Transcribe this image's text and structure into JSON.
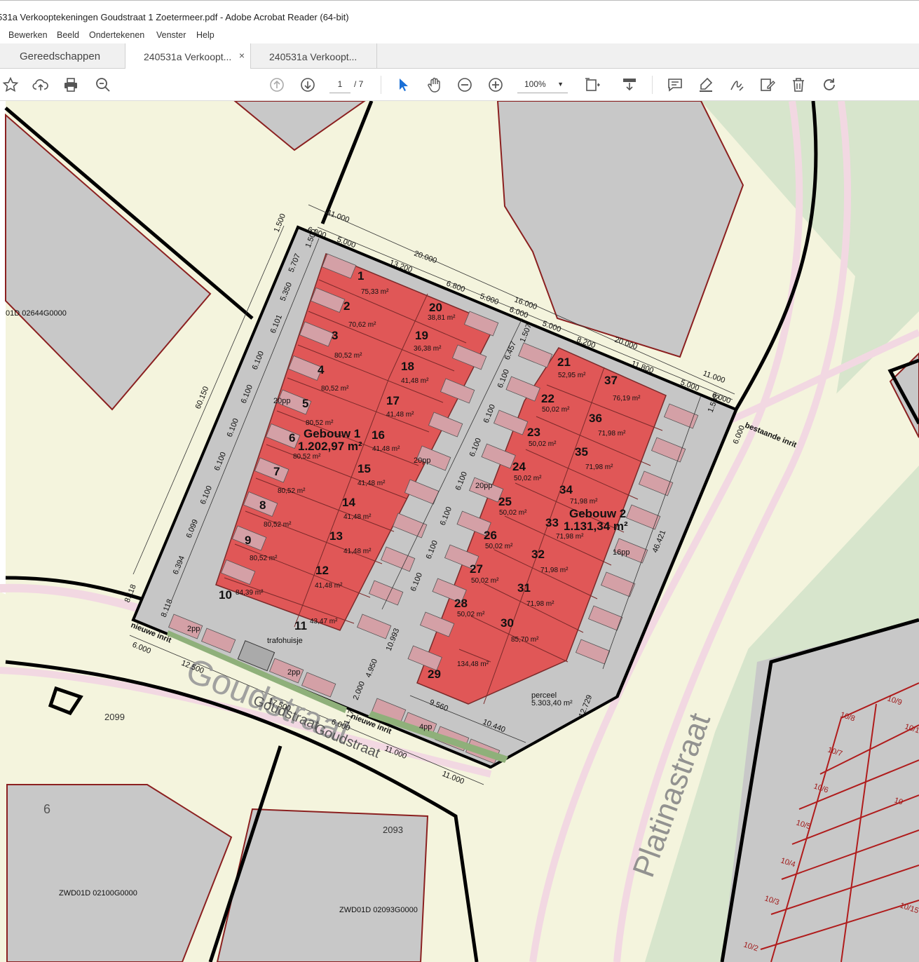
{
  "window": {
    "title": "531a Verkooptekeningen Goudstraat 1 Zoetermeer.pdf - Adobe Acrobat Reader (64-bit)"
  },
  "menu": [
    "Bewerken",
    "Beeld",
    "Ondertekenen",
    "Venster",
    "Help"
  ],
  "tabs": [
    {
      "label": "Gereedschappen"
    },
    {
      "label": "240531a Verkoopt...",
      "close": "×"
    },
    {
      "label": "240531a Verkoopt..."
    }
  ],
  "toolbar": {
    "page_current": "1",
    "page_total": "/ 7",
    "zoom": "100%",
    "icons": [
      "star-icon",
      "upload-cloud-icon",
      "print-icon",
      "search-icon",
      "page-up-icon",
      "page-down-icon",
      "select-arrow-icon",
      "hand-icon",
      "zoom-out-icon",
      "zoom-in-icon",
      "fit-page-icon",
      "scroll-mode-icon",
      "comment-icon",
      "highlight-icon",
      "sign-icon",
      "edit-icon",
      "delete-icon",
      "rotate-icon"
    ]
  },
  "colors": {
    "unit_fill": "#e05555",
    "parking_fill": "#d4a0a6",
    "site_fill": "#c9c9c9",
    "map_green": "#d9e6cf",
    "map_cream": "#f5f5dd",
    "boundary": "#000000"
  },
  "drawing": {
    "buildings": [
      {
        "name": "Gebouw 1",
        "area": "1.202,97 m²"
      },
      {
        "name": "Gebouw 2",
        "area": "1.131,34 m²"
      }
    ],
    "units": [
      {
        "n": "1",
        "area": "75,33 m²"
      },
      {
        "n": "2",
        "area": "70,62 m²"
      },
      {
        "n": "3",
        "area": "80,52 m²"
      },
      {
        "n": "4",
        "area": "80,52 m²"
      },
      {
        "n": "5",
        "area": "80,52 m²"
      },
      {
        "n": "6",
        "area": "80,52 m²"
      },
      {
        "n": "7",
        "area": "80,52 m²"
      },
      {
        "n": "8",
        "area": "80,52 m²"
      },
      {
        "n": "9",
        "area": "80,52 m²"
      },
      {
        "n": "10",
        "area": "84,39 m²"
      },
      {
        "n": "11",
        "area": "43,47 m²"
      },
      {
        "n": "12",
        "area": "41,48 m²"
      },
      {
        "n": "13",
        "area": "41,48 m²"
      },
      {
        "n": "14",
        "area": "41,48 m²"
      },
      {
        "n": "15",
        "area": "41,48 m²"
      },
      {
        "n": "16",
        "area": "41,48 m²"
      },
      {
        "n": "17",
        "area": "41,48 m²"
      },
      {
        "n": "18",
        "area": "41,48 m²"
      },
      {
        "n": "19",
        "area": "36,38 m²"
      },
      {
        "n": "20",
        "area": "38,81 m²"
      },
      {
        "n": "21",
        "area": "52,95 m²"
      },
      {
        "n": "22",
        "area": "50,02 m²"
      },
      {
        "n": "23",
        "area": "50,02 m²"
      },
      {
        "n": "24",
        "area": "50,02 m²"
      },
      {
        "n": "25",
        "area": "50,02 m²"
      },
      {
        "n": "26",
        "area": "50,02 m²"
      },
      {
        "n": "27",
        "area": "50,02 m²"
      },
      {
        "n": "28",
        "area": "50,02 m²"
      },
      {
        "n": "29",
        "area": "134,48 m²"
      },
      {
        "n": "30",
        "area": "85,70 m²"
      },
      {
        "n": "31",
        "area": "71,98 m²"
      },
      {
        "n": "32",
        "area": "71,98 m²"
      },
      {
        "n": "33",
        "area": "71,98 m²"
      },
      {
        "n": "34",
        "area": "71,98 m²"
      },
      {
        "n": "35",
        "area": "71,98 m²"
      },
      {
        "n": "36",
        "area": "71,98 m²"
      },
      {
        "n": "37",
        "area": "76,19 m²"
      }
    ],
    "parking": [
      "20pp",
      "20pp",
      "20pp",
      "16pp",
      "2pp",
      "2pp",
      "4pp"
    ],
    "perceel": {
      "label": "perceel",
      "area": "5.303,40 m²"
    },
    "labels": {
      "trafo": "trafohuisje",
      "entry_new_1": "nieuwe inrit",
      "entry_new_2": "nieuwe inrit",
      "entry_existing": "bestaande inrit",
      "street_1": "Goudstraat",
      "street_2": "Goudstraat",
      "street_3": "Goudstraat",
      "street_4": "Platinastraat",
      "parcel_1": "01D 02644G0000",
      "parcel_2": "ZWD01D 02100G0000",
      "parcel_3": "ZWD01D 02093G0000",
      "nr_2099": "2099",
      "nr_2093": "2093",
      "nr_6": "6"
    },
    "dims_top": [
      "11.000",
      "6.000",
      "5.000",
      "20.000",
      "13.200",
      "6.800",
      "5.000",
      "16.000",
      "6.000",
      "5.000",
      "8.200",
      "20.000",
      "11.800",
      "11.000",
      "5.000",
      "6.000"
    ],
    "dims_left": [
      "1.500",
      "1.500",
      "5.707",
      "5.350",
      "6.101",
      "6.100",
      "6.100",
      "6.100",
      "6.100",
      "6.100",
      "6.099",
      "6.394",
      "60.150",
      "8.118",
      "8.118"
    ],
    "dims_mid": [
      "6.457",
      "6.100",
      "6.100",
      "6.100",
      "6.100",
      "6.100",
      "6.100",
      "6.100",
      "1.507"
    ],
    "dims_bottom": [
      "6.000",
      "12.500",
      "17.500",
      "11.000",
      "11.000",
      "6.000",
      "2.000",
      "4.950",
      "10.993",
      "1.17",
      "9.560",
      "10.440",
      "12.729",
      "46.421",
      "6.000",
      "1.503"
    ],
    "plot_numbers": [
      "10/9",
      "10/8",
      "10/7",
      "10/6",
      "10/5",
      "10/4",
      "10/3",
      "10/2",
      "10/1",
      "10/15",
      "10"
    ]
  }
}
